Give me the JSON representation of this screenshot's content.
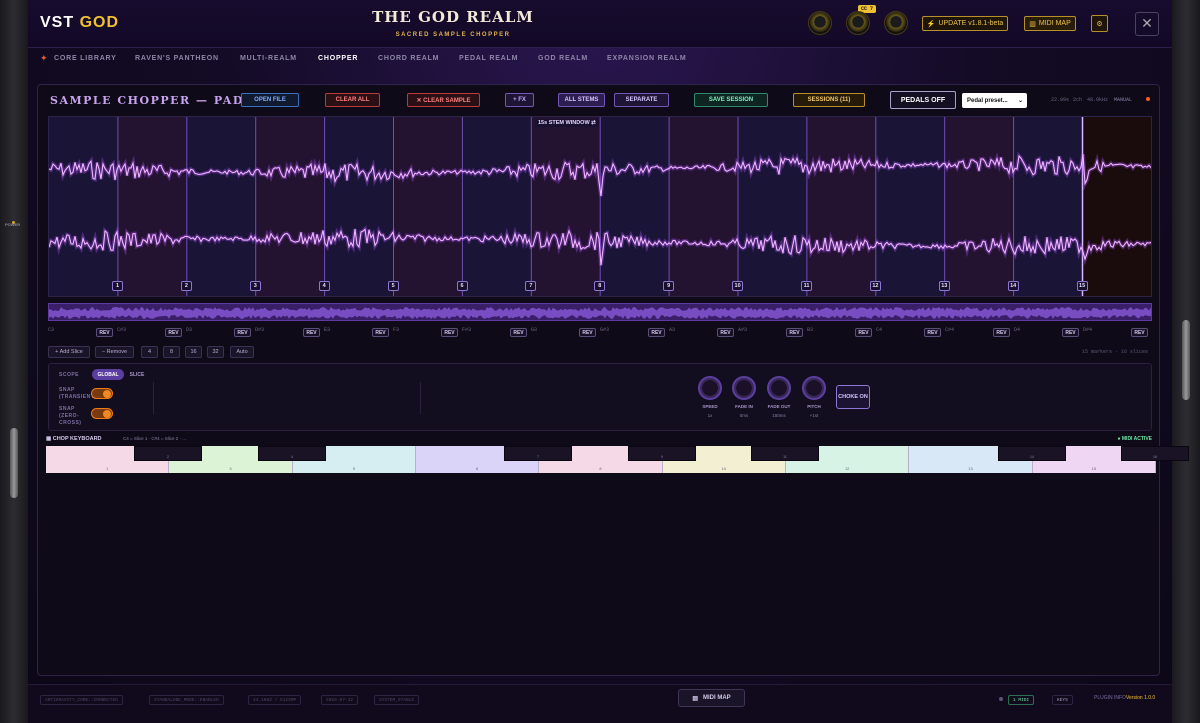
{
  "app": {
    "logo_a": "VST",
    "logo_b": "GOD",
    "title": "THE GOD REALM",
    "subtitle": "SACRED SAMPLE CHOPPER",
    "cc_badge": "CC 7",
    "update_label": "UPDATE v1.8.1-beta",
    "midimap_label": "MIDI MAP",
    "close_label": "✕",
    "power_label": "POWER"
  },
  "nav": {
    "items": [
      "CORE LIBRARY",
      "RAVEN'S PANTHEON",
      "MULTI-REALM",
      "CHOPPER",
      "CHORD REALM",
      "PEDAL REALM",
      "GOD REALM",
      "EXPANSION REALM"
    ],
    "active": "CHOPPER"
  },
  "chopper": {
    "title": "SAMPLE CHOPPER — PAD 1",
    "toolbar": {
      "open_file": "OPEN FILE",
      "clear_all": "CLEAR ALL",
      "clear_sample": "✕ CLEAR SAMPLE",
      "fx": "+ FX",
      "all_stems": "ALL STEMS",
      "separate": "SEPARATE",
      "save_session": "SAVE SESSION",
      "sessions": "SESSIONS (11)",
      "pedals": "PEDALS OFF",
      "pedal_preset": "Pedal preset..."
    },
    "info": {
      "time": "22.99s",
      "channels": "2ch",
      "rate": "48.0kHz",
      "mode": "MANUAL"
    },
    "stem_window": "15s STEM WINDOW ⇄",
    "slices": [
      "1",
      "2",
      "3",
      "4",
      "5",
      "6",
      "7",
      "8",
      "9",
      "10",
      "11",
      "12",
      "13",
      "14",
      "15"
    ],
    "notes": [
      "C3",
      "C#3",
      "D3",
      "D#3",
      "E3",
      "F3",
      "F#3",
      "G3",
      "G#3",
      "A3",
      "A#3",
      "B3",
      "C4",
      "C#4",
      "D4",
      "D#4"
    ],
    "rev_label": "REV",
    "controls": {
      "add": "+ Add Slice",
      "remove": "− Remove",
      "opts": [
        "4",
        "8",
        "16",
        "32",
        "Auto"
      ],
      "summary": "15 markers · 16 slices"
    },
    "scope": {
      "label": "SCOPE",
      "global": "GLOBAL",
      "slice": "SLICE",
      "snap_transient": "SNAP (TRANSIENT)",
      "snap_zero": "SNAP (ZERO-CROSS)"
    },
    "dials": [
      {
        "name": "SPEED",
        "value": "1x"
      },
      {
        "name": "FADE IN",
        "value": "0ms"
      },
      {
        "name": "FADE OUT",
        "value": "150ms"
      },
      {
        "name": "PITCH",
        "value": "+1st"
      }
    ],
    "choke": "CHOKE ON",
    "keyboard": {
      "title": "CHOP KEYBOARD",
      "subtitle": "C4 = Slice 1 · C#4 = Slice 2 · ...",
      "status": "● MIDI ACTIVE",
      "white": [
        "1",
        "3",
        "5",
        "6",
        "8",
        "10",
        "12",
        "13",
        "15"
      ],
      "black": [
        "2",
        "4",
        "7",
        "9",
        "11",
        "14",
        "16"
      ]
    }
  },
  "footer": {
    "chips": [
      "ANTIGRAVITY_CORE::CONNECTED",
      "STANDALONE_MODE::ENABLED",
      "44.1KHZ / 512SMP",
      "2026-07-12",
      "SYSTEM_STABLE"
    ],
    "midimap": "MIDI MAP",
    "midi": "1 MIDI",
    "keys": "KEYS",
    "plugin": "PLUGIN INFO",
    "version": "Version 1.0.0"
  },
  "colors": {
    "accent": "#c46bff",
    "gold": "#f0c030",
    "bg": "#0f0a18"
  }
}
